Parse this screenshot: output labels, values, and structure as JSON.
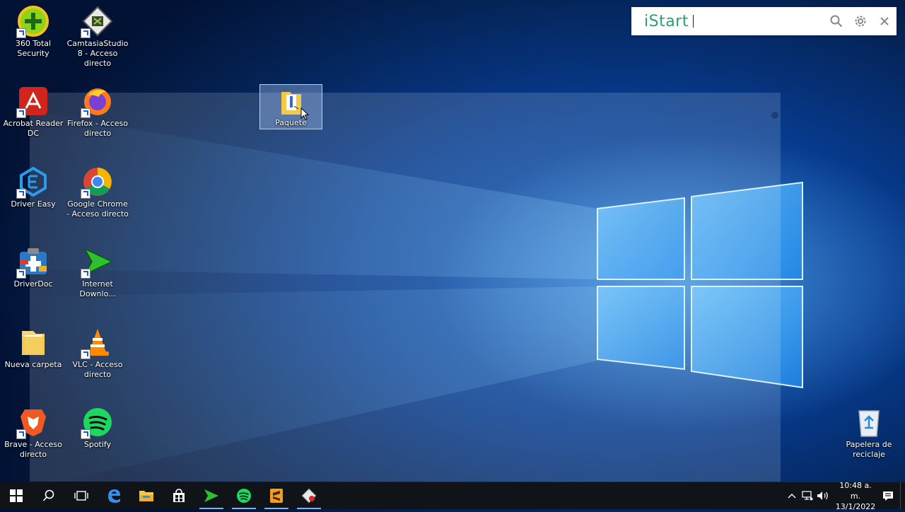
{
  "desktop": {
    "icons": [
      {
        "label": "360 Total Security"
      },
      {
        "label": "CamtasiaStudio 8 - Acceso directo"
      },
      {
        "label": "Acrobat Reader DC"
      },
      {
        "label": "Firefox - Acceso directo"
      },
      {
        "label": "Driver Easy"
      },
      {
        "label": "Google Chrome - Acceso directo"
      },
      {
        "label": "DriverDoc"
      },
      {
        "label": "Internet Downlo..."
      },
      {
        "label": "Nueva carpeta"
      },
      {
        "label": "VLC - Acceso directo"
      },
      {
        "label": "Brave - Acceso directo"
      },
      {
        "label": "Spotify"
      },
      {
        "label": "Paquete"
      },
      {
        "label": "Papelera de reciclaje"
      }
    ]
  },
  "istart": {
    "brand": "iStart",
    "icons": [
      "search-icon",
      "gear-icon",
      "close-icon"
    ]
  },
  "taskbar": {
    "clock_time": "10:48 a. m.",
    "clock_date": "13/1/2022",
    "apps": [
      "start-icon",
      "search-icon",
      "task-view-icon",
      "edge-icon",
      "file-explorer-icon",
      "store-icon",
      "internet-download-manager-icon",
      "spotify-icon",
      "sublime-icon",
      "camtasia-icon"
    ],
    "tray": [
      "chevron-up-icon",
      "network-icon",
      "volume-icon",
      "notification-icon"
    ]
  },
  "colors": {
    "taskbar_bg": "#101418",
    "istart_brand": "#29a36a",
    "desktop_blue": "#0d5cc0"
  }
}
